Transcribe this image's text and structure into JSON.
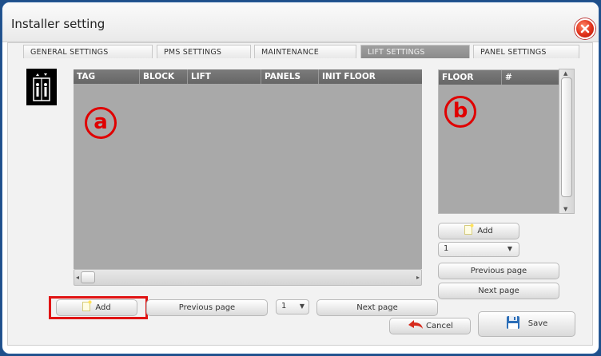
{
  "window": {
    "title": "Installer setting"
  },
  "tabs": [
    {
      "label": "GENERAL SETTINGS",
      "active": false
    },
    {
      "label": "PMS SETTINGS",
      "active": false
    },
    {
      "label": "MAINTENANCE",
      "active": false
    },
    {
      "label": "LIFT SETTINGS",
      "active": true
    },
    {
      "label": "PANEL SETTINGS",
      "active": false
    }
  ],
  "lift_table": {
    "columns": [
      "TAG",
      "BLOCK",
      "LIFT",
      "PANELS",
      "INIT FLOOR"
    ],
    "rows": []
  },
  "floor_table": {
    "columns": [
      "FLOOR",
      "#"
    ],
    "rows": []
  },
  "annotations": {
    "a": "a",
    "b": "b"
  },
  "bottom_bar": {
    "add_label": "Add",
    "previous_label": "Previous page",
    "page_value": "1",
    "next_label": "Next page",
    "cancel_label": "Cancel",
    "save_label": "Save"
  },
  "floor_controls": {
    "add_label": "Add",
    "page_value": "1",
    "previous_label": "Previous page",
    "next_label": "Next page"
  },
  "colors": {
    "highlight": "#e01414",
    "active_tab": "#8a8a8a",
    "grid": "#a9a9a9"
  },
  "icons": [
    "close-icon",
    "lift-icon",
    "add-icon",
    "undo-icon",
    "save-icon"
  ]
}
